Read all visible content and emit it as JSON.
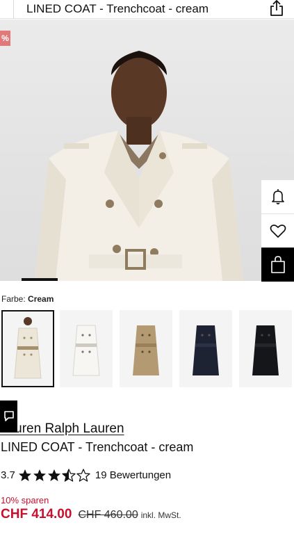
{
  "header": {
    "title": "LINED COAT - Trenchcoat - cream"
  },
  "hero": {
    "discount_flag": "%"
  },
  "color": {
    "label": "Farbe:",
    "value": "Cream"
  },
  "swatches": [
    {
      "name": "cream",
      "fill": "#ece6d9",
      "selected": true
    },
    {
      "name": "white",
      "fill": "#f3f1ec",
      "selected": false
    },
    {
      "name": "khaki",
      "fill": "#b49a72",
      "selected": false
    },
    {
      "name": "navy",
      "fill": "#1d2333",
      "selected": false
    },
    {
      "name": "black",
      "fill": "#15161a",
      "selected": false
    }
  ],
  "product": {
    "brand": "Lauren Ralph Lauren",
    "name": "LINED COAT - Trenchcoat - cream"
  },
  "rating": {
    "score": "3.7",
    "stars": 3.7,
    "reviews": "19 Bewertungen"
  },
  "pricing": {
    "save_label": "10% sparen",
    "price": "CHF 414.00",
    "old_price": "CHF 460.00",
    "vat_note": "inkl. MwSt."
  },
  "colors": {
    "sale": "#c8102e",
    "accent": "#000000"
  }
}
